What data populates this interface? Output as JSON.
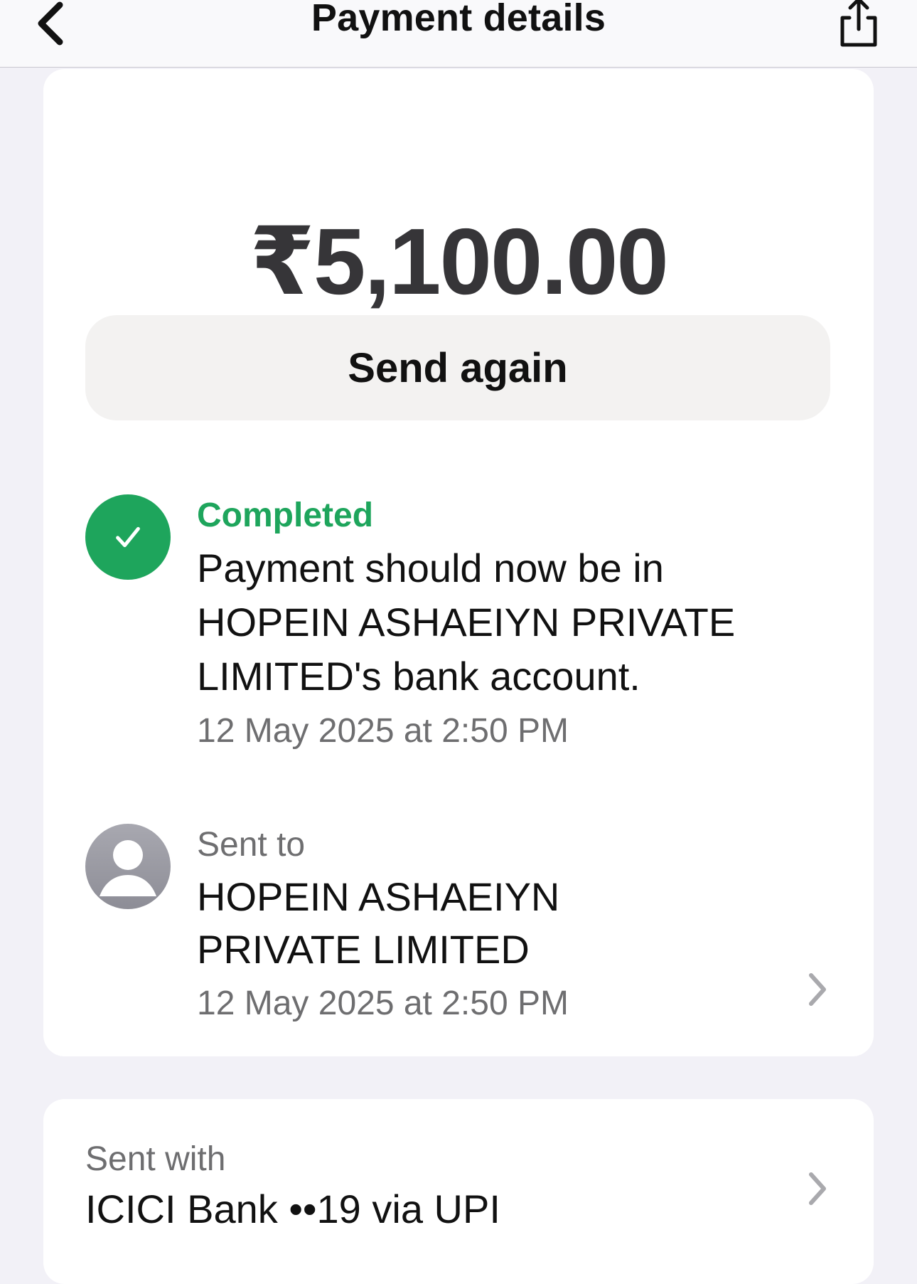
{
  "header": {
    "title": "Payment details",
    "back_icon": "chevron-left-icon",
    "share_icon": "share-icon"
  },
  "payment": {
    "amount": "₹5,100.00",
    "send_again_label": "Send again"
  },
  "status": {
    "icon": "check-circle-icon",
    "label": "Completed",
    "message": "Payment should now be in HOPEIN ASHAEIYN PRIVATE LIMITED's bank account.",
    "timestamp": "12 May 2025 at 2:50 PM"
  },
  "recipient": {
    "icon": "person-avatar-icon",
    "label": "Sent to",
    "name": "HOPEIN ASHAEIYN PRIVATE LIMITED",
    "timestamp": "12 May 2025 at 2:50 PM"
  },
  "source": {
    "label": "Sent with",
    "value": "ICICI Bank ••19 via UPI"
  },
  "colors": {
    "success_green": "#1ea55c",
    "page_background": "#f2f1f7",
    "card_background": "#ffffff",
    "secondary_text": "#6e6e70",
    "button_background": "#f3f2f1"
  }
}
